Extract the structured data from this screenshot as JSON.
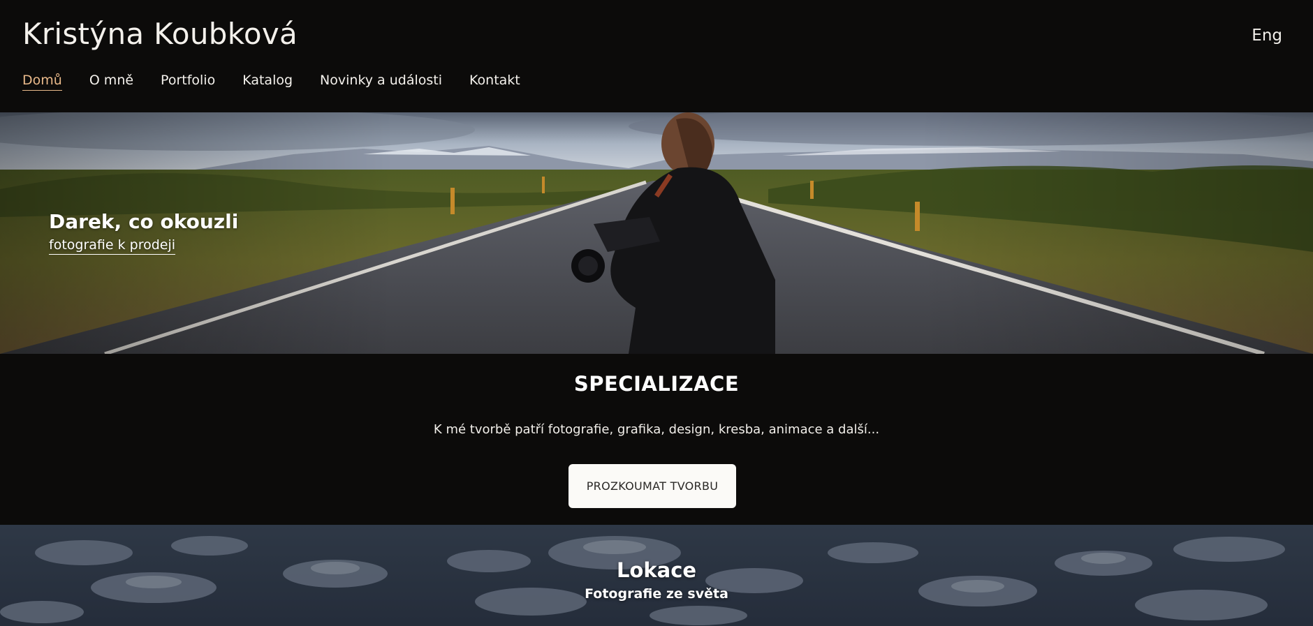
{
  "header": {
    "site_title": "Kristýna Koubková",
    "language_switch": "Eng",
    "nav": [
      {
        "label": "Domů",
        "active": true
      },
      {
        "label": "O mně",
        "active": false
      },
      {
        "label": "Portfolio",
        "active": false
      },
      {
        "label": "Katalog",
        "active": false
      },
      {
        "label": "Novinky a události",
        "active": false
      },
      {
        "label": "Kontakt",
        "active": false
      }
    ]
  },
  "hero": {
    "heading": "Darek, co okouzli",
    "link_text": "fotografie k prodeji"
  },
  "specialization": {
    "title": "SPECIALIZACE",
    "text": "K mé tvorbě patří fotografie, grafika, design, kresba, animace a další...",
    "button_label": "PROZKOUMAT TVORBU"
  },
  "locations": {
    "title": "Lokace",
    "subtitle": "Fotografie ze světa"
  },
  "colors": {
    "background": "#0c0b0a",
    "nav_active": "#e9b98a",
    "button_background": "#fbfaf7"
  }
}
